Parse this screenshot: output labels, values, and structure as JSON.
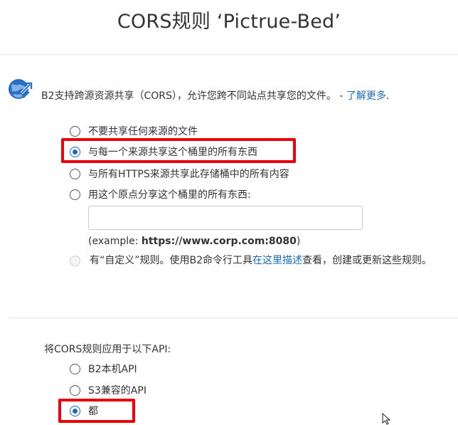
{
  "dialog": {
    "title": "CORS规则 ‘Pictrue-Bed’"
  },
  "intro": {
    "text": "B2支持跨源资源共享（CORS），允许您跨不同站点共享您的文件。 - ",
    "link": "了解更多",
    "end": "."
  },
  "sharing_options": [
    {
      "label": "不要共享任何来源的文件",
      "checked": false,
      "disabled": false
    },
    {
      "label": "与每一个来源共享这个桶里的所有东西",
      "checked": true,
      "disabled": false
    },
    {
      "label": "与所有HTTPS来源共享此存储桶中的所有内容",
      "checked": false,
      "disabled": false
    },
    {
      "label": "用这个原点分享这个桶里的所有东西:",
      "checked": false,
      "disabled": false
    },
    {
      "label": "",
      "checked": false,
      "disabled": true
    }
  ],
  "origin_input": {
    "value": "",
    "example_prefix": "(example: ",
    "example_value": "https://www.corp.com:8080",
    "example_suffix": ")"
  },
  "custom_rules": {
    "text_before": "有“自定义”规则。使用B2命令行工具",
    "link": "在这里描述",
    "text_after": "查看，创建或更新这些规则。"
  },
  "api_section": {
    "label": "将CORS规则应用于以下API:",
    "options": [
      {
        "label": "B2本机API",
        "checked": false
      },
      {
        "label": "S3兼容的API",
        "checked": false
      },
      {
        "label": "都",
        "checked": true
      }
    ]
  },
  "colors": {
    "accent": "#1a66c9",
    "link": "#1a6bb5",
    "highlight_border": "#e8000b",
    "divider": "#e6e6e6"
  },
  "icons": {
    "intro": "globe-share-icon",
    "pointer": "mouse-cursor-icon"
  }
}
